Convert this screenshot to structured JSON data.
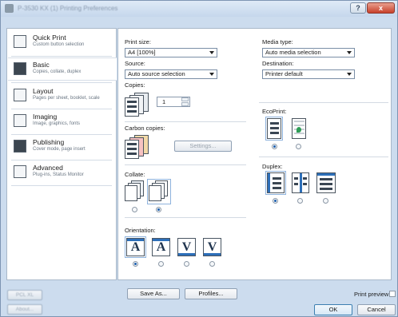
{
  "window": {
    "title": "P-3530 KX (1) Printing Preferences"
  },
  "titlebar": {
    "help": "?",
    "close": "x"
  },
  "sidebar": {
    "items": [
      {
        "label": "Quick Print",
        "sub": "Custom button selection",
        "icon": "quick-print-icon"
      },
      {
        "label": "Basic",
        "sub": "Copies, collate, duplex",
        "icon": "printer-icon"
      },
      {
        "label": "Layout",
        "sub": "Pages per sheet, booklet, scale",
        "icon": "layout-icon"
      },
      {
        "label": "Imaging",
        "sub": "Image, graphics, fonts",
        "icon": "imaging-icon"
      },
      {
        "label": "Publishing",
        "sub": "Cover mode, page insert",
        "icon": "publishing-icon"
      },
      {
        "label": "Advanced",
        "sub": "Plug-ins, Status Monitor",
        "icon": "advanced-icon"
      }
    ],
    "active_index": 1
  },
  "main": {
    "print_size": {
      "label": "Print size:",
      "value": "A4 [100%]"
    },
    "source": {
      "label": "Source:",
      "value": "Auto source selection"
    },
    "copies": {
      "label": "Copies:",
      "value": "1"
    },
    "carbon_copies": {
      "label": "Carbon copies:",
      "settings_button": "Settings..."
    },
    "collate": {
      "label": "Collate:"
    },
    "orientation": {
      "label": "Orientation:",
      "glyphs": [
        "A",
        "A",
        "V",
        "V"
      ],
      "selected_index": 0
    },
    "media_type": {
      "label": "Media type:",
      "value": "Auto media selection"
    },
    "destination": {
      "label": "Destination:",
      "value": "Printer default"
    },
    "ecoprint": {
      "label": "EcoPrint:",
      "selected_index": 0
    },
    "duplex": {
      "label": "Duplex:",
      "selected_index": 0
    },
    "collate_selected_index": 1
  },
  "footer": {
    "profile_tag": "PCL XL",
    "about_button": "About...",
    "save_as_button": "Save As...",
    "profiles_button": "Profiles...",
    "print_preview_label": "Print preview",
    "ok_button": "OK",
    "cancel_button": "Cancel"
  }
}
